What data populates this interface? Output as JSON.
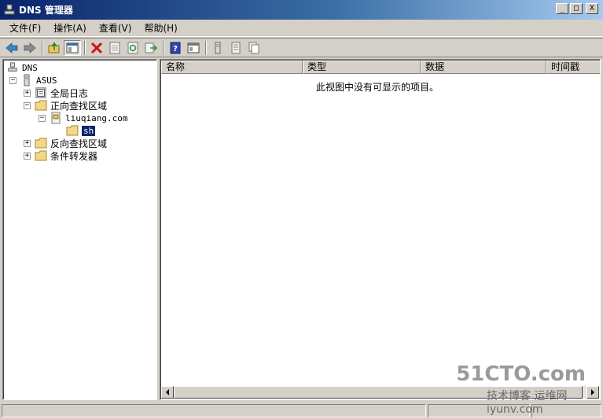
{
  "window": {
    "title": "DNS 管理器",
    "controls": {
      "minimize": "_",
      "maximize": "□",
      "close": "X"
    }
  },
  "menu": [
    "文件(F)",
    "操作(A)",
    "查看(V)",
    "帮助(H)"
  ],
  "toolbar": [
    "back-icon",
    "forward-icon",
    "up-folder-icon",
    "show-hide-tree-icon",
    "delete-icon",
    "properties-icon",
    "refresh-icon",
    "export-icon",
    "help-icon",
    "view-icon",
    "server-icon",
    "list-icon",
    "copy-icon"
  ],
  "tree": {
    "root": "DNS",
    "server": "ASUS",
    "global_logs": "全局日志",
    "forward_zones": "正向查找区域",
    "zone": "liuqiang.com",
    "subdomain": "sh",
    "reverse_zones": "反向查找区域",
    "conditional_forwarders": "条件转发器",
    "expanders": {
      "plus": "+",
      "minus": "−"
    }
  },
  "list": {
    "columns": [
      "名称",
      "类型",
      "数据",
      "时间戳"
    ],
    "empty_message": "此视图中没有可显示的项目。"
  },
  "watermark": {
    "line1": "51CTO.com",
    "line2": "技术博客 运维网 iyunv.com"
  },
  "colors": {
    "titlebar_start": "#0a246a",
    "titlebar_end": "#a6caf0",
    "selection": "#0a246a",
    "face": "#d4d0c8"
  }
}
